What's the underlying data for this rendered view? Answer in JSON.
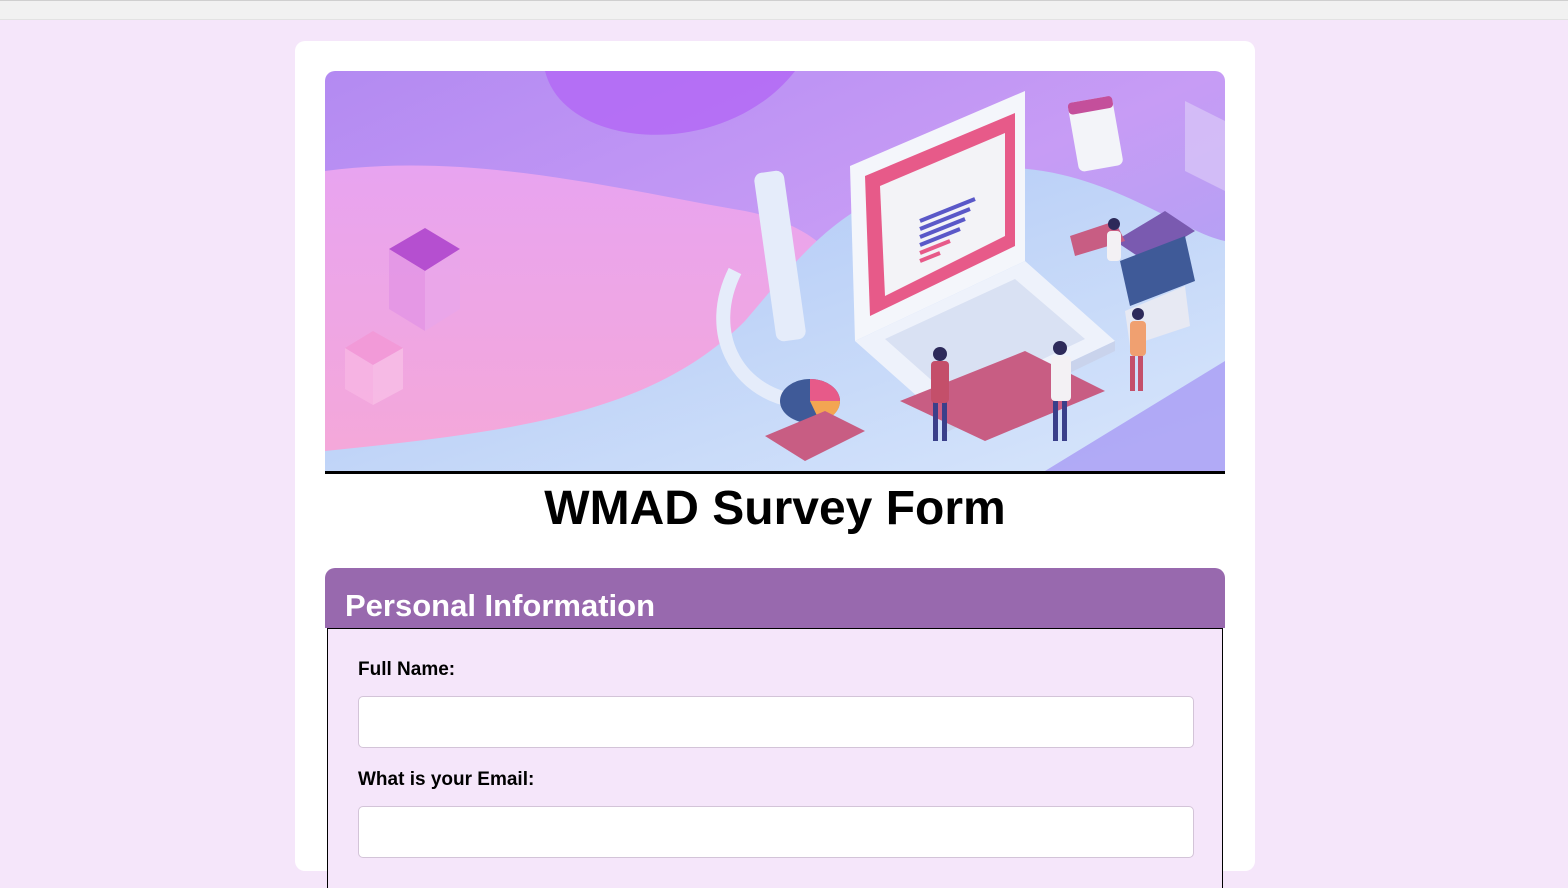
{
  "page": {
    "title": "WMAD Survey Form"
  },
  "banner": {
    "image": "survey-illustration-laptop-people"
  },
  "sections": [
    {
      "heading": "Personal Information",
      "fields": [
        {
          "label": "Full Name:",
          "value": "",
          "placeholder": ""
        },
        {
          "label": "What is your Email:",
          "value": "",
          "placeholder": ""
        }
      ]
    }
  ],
  "colors": {
    "page_background": "#f5e6fa",
    "card_background": "#ffffff",
    "section_header": "#9869ae",
    "section_header_text": "#ffffff",
    "fieldset_background": "#f5e6fa"
  }
}
